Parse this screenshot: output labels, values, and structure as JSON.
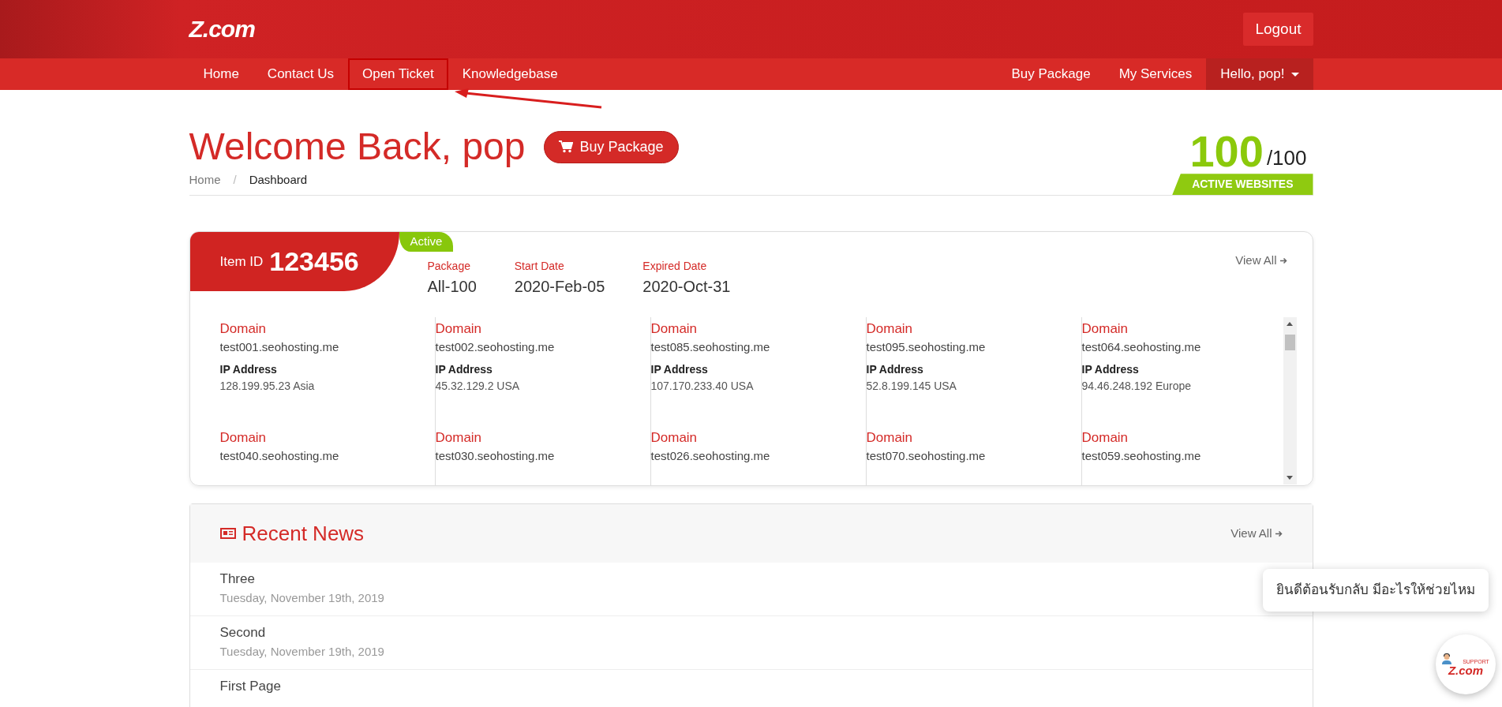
{
  "logo": {
    "text": "Z.com"
  },
  "logout": "Logout",
  "nav": {
    "left": [
      {
        "label": "Home",
        "highlighted": false
      },
      {
        "label": "Contact Us",
        "highlighted": false
      },
      {
        "label": "Open Ticket",
        "highlighted": true
      },
      {
        "label": "Knowledgebase",
        "highlighted": false
      }
    ],
    "right": [
      {
        "label": "Buy Package",
        "kind": "link"
      },
      {
        "label": "My Services",
        "kind": "link"
      },
      {
        "label": "Hello, pop!",
        "kind": "dropdown"
      }
    ]
  },
  "welcome": {
    "title": "Welcome Back, pop",
    "button": "Buy Package",
    "breadcrumb_separator": "/",
    "breadcrumb": [
      {
        "label": "Home",
        "selected": false
      },
      {
        "label": "Dashboard",
        "selected": true
      }
    ],
    "websites": {
      "count": "100",
      "total": "/100",
      "label": "ACTIVE WEBSITES"
    }
  },
  "item": {
    "id_label": "Item ID",
    "id": "123456",
    "status": "Active",
    "fields": [
      {
        "label": "Package",
        "value": "All-100"
      },
      {
        "label": "Start Date",
        "value": "2020-Feb-05"
      },
      {
        "label": "Expired Date",
        "value": "2020-Oct-31"
      }
    ],
    "view_all": "View All",
    "domains": [
      {
        "domain_label": "Domain",
        "domain": "test001.seohosting.me",
        "ip_label": "IP Address",
        "ip": "128.199.95.23 Asia"
      },
      {
        "domain_label": "Domain",
        "domain": "test002.seohosting.me",
        "ip_label": "IP Address",
        "ip": "45.32.129.2 USA"
      },
      {
        "domain_label": "Domain",
        "domain": "test085.seohosting.me",
        "ip_label": "IP Address",
        "ip": "107.170.233.40 USA"
      },
      {
        "domain_label": "Domain",
        "domain": "test095.seohosting.me",
        "ip_label": "IP Address",
        "ip": "52.8.199.145 USA"
      },
      {
        "domain_label": "Domain",
        "domain": "test064.seohosting.me",
        "ip_label": "IP Address",
        "ip": "94.46.248.192 Europe"
      },
      {
        "domain_label": "Domain",
        "domain": "test040.seohosting.me"
      },
      {
        "domain_label": "Domain",
        "domain": "test030.seohosting.me"
      },
      {
        "domain_label": "Domain",
        "domain": "test026.seohosting.me"
      },
      {
        "domain_label": "Domain",
        "domain": "test070.seohosting.me"
      },
      {
        "domain_label": "Domain",
        "domain": "test059.seohosting.me"
      }
    ]
  },
  "news": {
    "title": "Recent News",
    "view_all": "View All",
    "items": [
      {
        "title": "Three",
        "date": "Tuesday, November 19th, 2019"
      },
      {
        "title": "Second",
        "date": "Tuesday, November 19th, 2019"
      },
      {
        "title": "First Page"
      }
    ]
  },
  "chat": {
    "message": "ยินดีต้อนรับกลับ มีอะไรให้ช่วยไหม",
    "badge_top": "SUPPORT",
    "badge_logo": "Z.com"
  }
}
